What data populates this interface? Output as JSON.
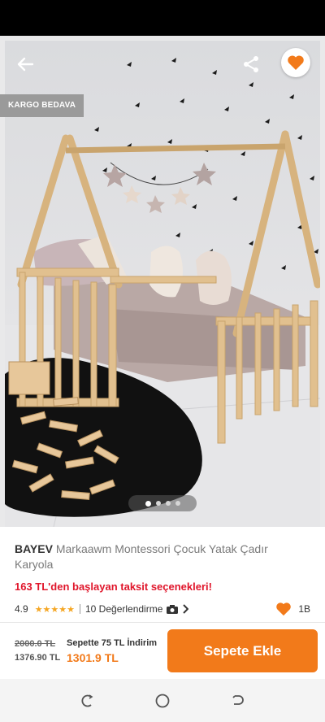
{
  "status_bar": {},
  "gallery": {
    "badge": "KARGO BEDAVA",
    "page_count": 4,
    "current_page": 1
  },
  "product": {
    "brand": "BAYEV",
    "name": "Markaawm Montessori Çocuk Yatak Çadır Karyola",
    "installment_text": "163 TL'den başlayan taksit seçenekleri!",
    "rating": "4.9",
    "stars": 5,
    "review_text": "10 Değerlendirme",
    "favorite_count": "1B"
  },
  "pricing": {
    "old_price": "2000.0 TL",
    "sale_price": "1376.90 TL",
    "cart_discount": "Sepette 75 TL İndirim",
    "final_price": "1301.9 TL",
    "add_to_cart_label": "Sepete Ekle"
  },
  "colors": {
    "accent_orange": "#f27a1a",
    "installment_red": "#e0162b",
    "star_yellow": "#f5a623"
  },
  "icons": [
    "back-arrow-icon",
    "share-icon",
    "heart-icon",
    "camera-icon",
    "chevron-right-icon",
    "recent-apps-icon",
    "home-icon",
    "back-nav-icon"
  ]
}
